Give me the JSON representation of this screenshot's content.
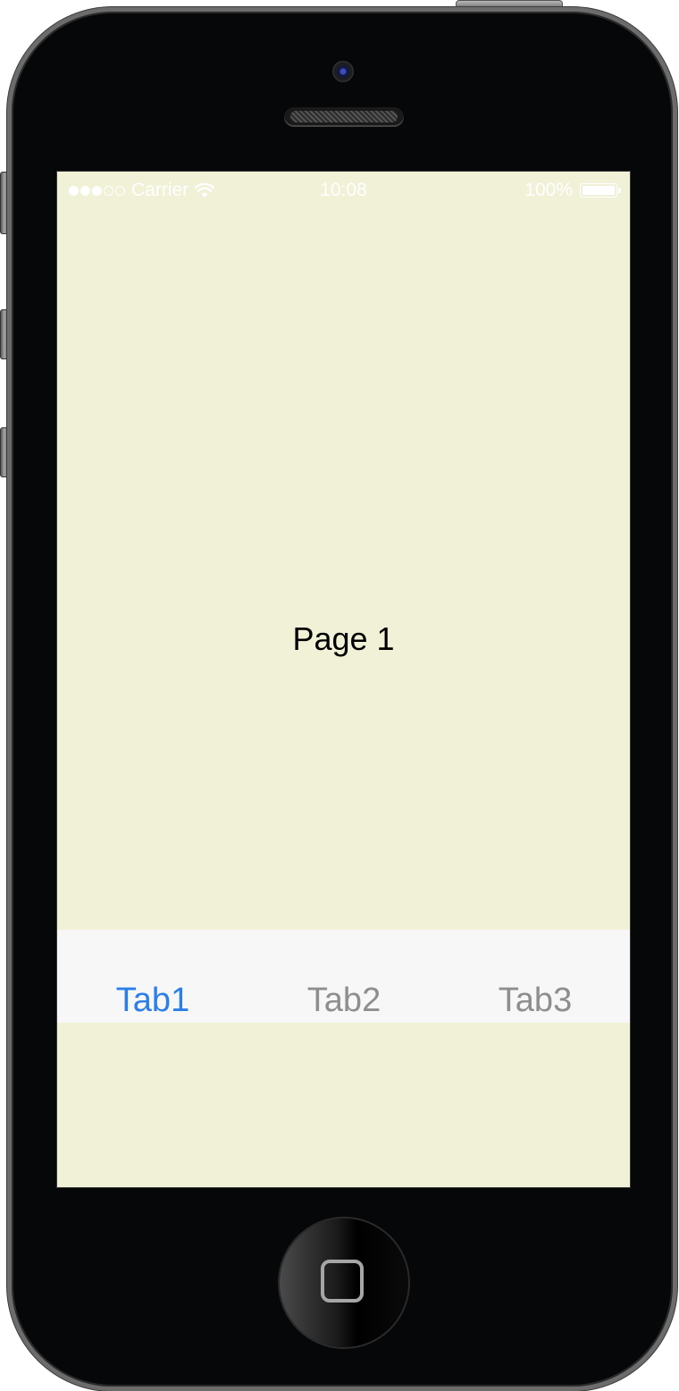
{
  "status_bar": {
    "carrier": "Carrier",
    "time": "10:08",
    "battery": "100%",
    "signal_strength": {
      "filled": 3,
      "total": 5
    },
    "icons": [
      "wifi-icon",
      "battery-icon"
    ]
  },
  "main": {
    "page_title": "Page 1"
  },
  "tab_bar": {
    "tabs": [
      {
        "label": "Tab1",
        "selected": true
      },
      {
        "label": "Tab2",
        "selected": false
      },
      {
        "label": "Tab3",
        "selected": false
      }
    ]
  },
  "colors": {
    "screen_background": "#f1f1d7",
    "tab_bar_background": "#f7f7f7",
    "tab_active": "#2c7ee8",
    "tab_inactive": "#8e8e8e",
    "device_body": "#050708"
  }
}
